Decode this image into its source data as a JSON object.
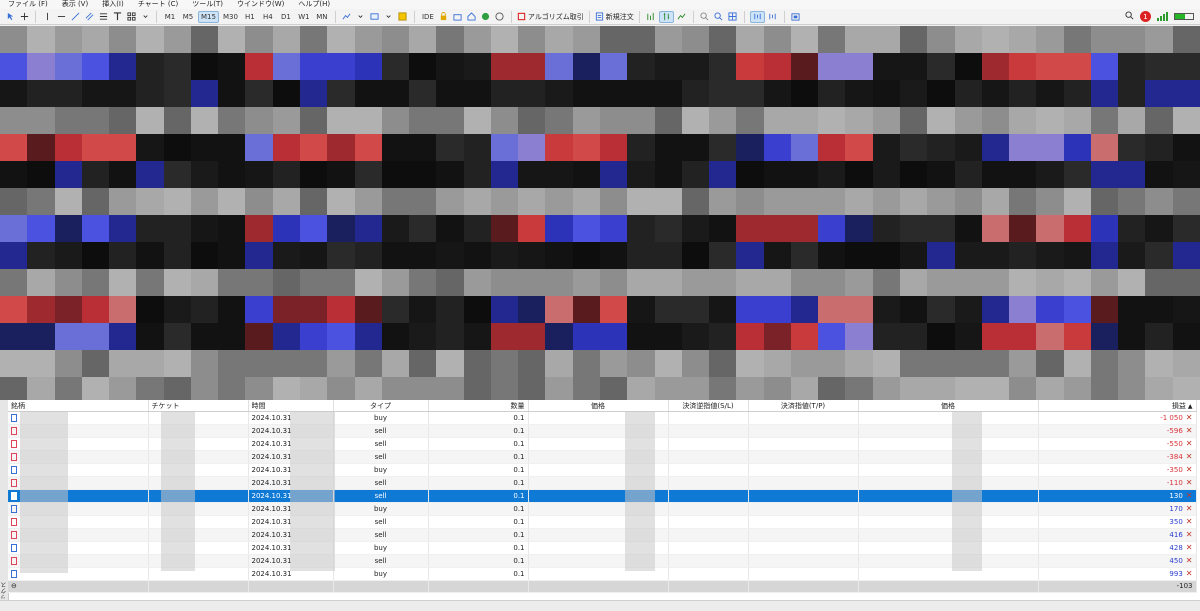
{
  "menu": [
    "ファイル (F)",
    "表示 (V)",
    "挿入(I)",
    "チャート (C)",
    "ツール(T)",
    "ウインドウ(W)",
    "ヘルプ(H)"
  ],
  "toolbar": {
    "timeframes": [
      "M1",
      "M5",
      "M15",
      "M30",
      "H1",
      "H4",
      "D1",
      "W1",
      "MN"
    ],
    "active_timeframe": "M15",
    "ide_label": "IDE",
    "algo_label": "アルゴリズム取引",
    "new_order_label": "新規注文",
    "notification_count": "1"
  },
  "colors": {
    "accent": "#0f79d6",
    "loss": "#d9343a",
    "profit": "#2a3ed0"
  },
  "table": {
    "headers": [
      "銘柄",
      "チケット",
      "時間",
      "タイプ",
      "数量",
      "価格",
      "決済逆指値(S/L)",
      "決済指値(T/P)",
      "価格",
      "損益"
    ],
    "sort_indicator": "▲",
    "rows": [
      {
        "time": "2024.10.31",
        "type": "buy",
        "volume": "0.1",
        "profit": "-1 050"
      },
      {
        "time": "2024.10.31",
        "type": "sell",
        "volume": "0.1",
        "profit": "-596"
      },
      {
        "time": "2024.10.31",
        "type": "sell",
        "volume": "0.1",
        "profit": "-550"
      },
      {
        "time": "2024.10.31",
        "type": "sell",
        "volume": "0.1",
        "profit": "-384"
      },
      {
        "time": "2024.10.31",
        "type": "buy",
        "volume": "0.1",
        "profit": "-350"
      },
      {
        "time": "2024.10.31",
        "type": "sell",
        "volume": "0.1",
        "profit": "-110"
      },
      {
        "time": "2024.10.31",
        "type": "sell",
        "volume": "0.1",
        "profit": "130"
      },
      {
        "time": "2024.10.31",
        "type": "buy",
        "volume": "0.1",
        "profit": "170"
      },
      {
        "time": "2024.10.31",
        "type": "sell",
        "volume": "0.1",
        "profit": "350"
      },
      {
        "time": "2024.10.31",
        "type": "sell",
        "volume": "0.1",
        "profit": "416"
      },
      {
        "time": "2024.10.31",
        "type": "buy",
        "volume": "0.1",
        "profit": "428"
      },
      {
        "time": "2024.10.31",
        "type": "sell",
        "volume": "0.1",
        "profit": "450"
      },
      {
        "time": "2024.10.31",
        "type": "buy",
        "volume": "0.1",
        "profit": "993"
      }
    ],
    "selected_row": 6,
    "total_profit": "-103"
  },
  "side_tab_label": "ボックス"
}
